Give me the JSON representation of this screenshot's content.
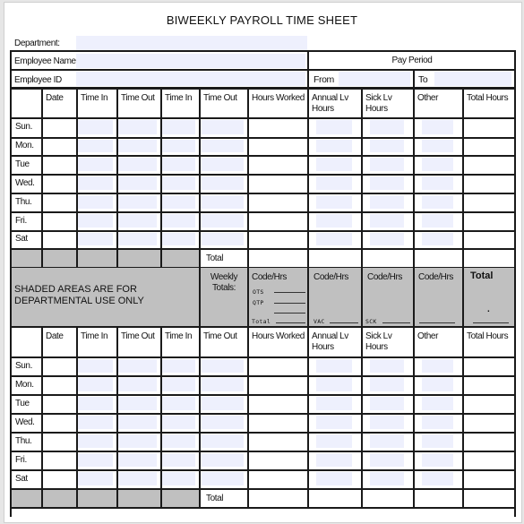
{
  "title": "BIWEEKLY PAYROLL TIME SHEET",
  "header": {
    "department_label": "Department:",
    "employee_name_label": "Employee Name",
    "employee_id_label": "Employee ID",
    "pay_period_label": "Pay Period",
    "from_label": "From",
    "to_label": "To"
  },
  "columns": {
    "date": "Date",
    "time_in_1": "Time In",
    "time_out_1": "Time Out",
    "time_in_2": "Time In",
    "time_out_2": "Time Out",
    "hours_worked": "Hours Worked",
    "annual_lv": "Annual Lv Hours",
    "sick_lv": "Sick Lv Hours",
    "other": "Other",
    "total_hours": "Total Hours"
  },
  "days": [
    "Sun.",
    "Mon.",
    "Tue",
    "Wed.",
    "Thu.",
    "Fri.",
    "Sat"
  ],
  "total_label": "Total",
  "dept_section": {
    "notice": "SHADED AREAS ARE FOR DEPARTMENTAL USE ONLY",
    "weekly_totals": "Weekly Totals:",
    "code_hrs": "Code/Hrs",
    "ots": "OTS",
    "qtp": "QTP",
    "total_small": "Total",
    "vac": "VAC",
    "sck": "SCK",
    "total": "Total",
    "dot": "."
  },
  "colors": {
    "input_fill": "#eef0fd",
    "shade": "#c0c0c0",
    "line": "#1a1a1a"
  }
}
